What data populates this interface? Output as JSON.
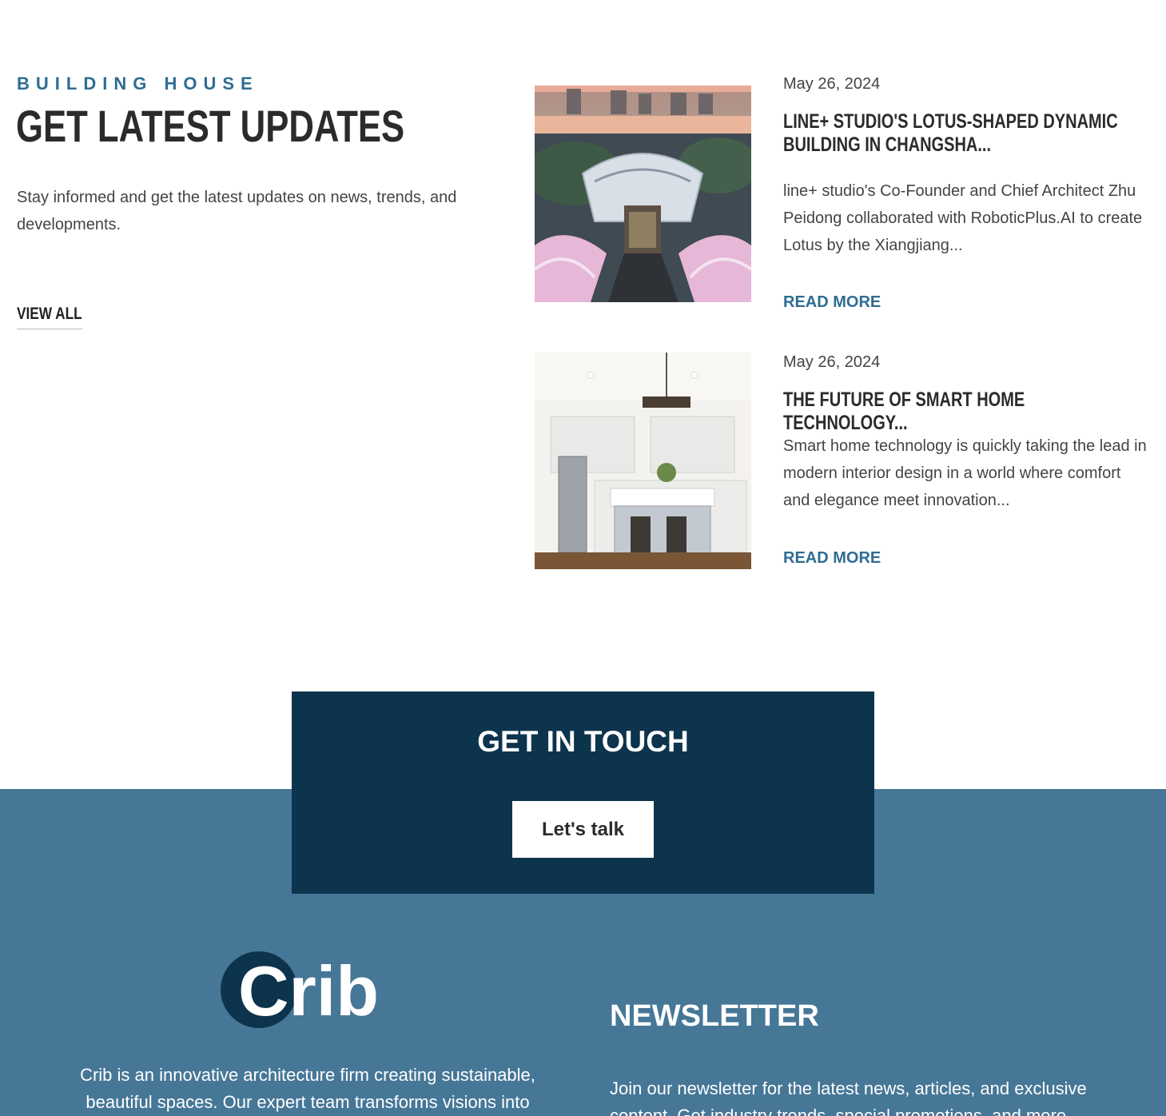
{
  "updates": {
    "eyebrow": "BUILDING HOUSE",
    "title": "GET LATEST UPDATES",
    "intro": "Stay informed and get the latest updates on news, trends, and developments.",
    "view_all": "VIEW ALL"
  },
  "posts": [
    {
      "date": "May 26, 2024",
      "title": "LINE+ STUDIO'S LOTUS-SHAPED DYNAMIC BUILDING IN CHANGSHA...",
      "excerpt": "line+ studio's Co-Founder and Chief Architect Zhu Peidong collaborated with RoboticPlus.AI to create Lotus by the Xiangjiang...",
      "read_more": "READ MORE"
    },
    {
      "date": "May 26, 2024",
      "title": "THE FUTURE OF SMART HOME TECHNOLOGY...",
      "excerpt": "Smart home technology is quickly taking the lead in modern interior design in a world where comfort and elegance meet innovation...",
      "read_more": "READ MORE"
    }
  ],
  "cta": {
    "title": "GET IN TOUCH",
    "button": "Let's talk"
  },
  "footer": {
    "logo_text": "Crib",
    "about": "Crib is an innovative architecture firm creating sustainable, beautiful spaces. Our expert team transforms visions into",
    "newsletter_title": "NEWSLETTER",
    "newsletter_text": "Join our newsletter for the latest news, articles, and exclusive content. Get industry trends, special promotions, and more."
  },
  "colors": {
    "accent": "#2f6d92",
    "cta_bg": "#0d344d",
    "footer_bg": "#467797"
  }
}
